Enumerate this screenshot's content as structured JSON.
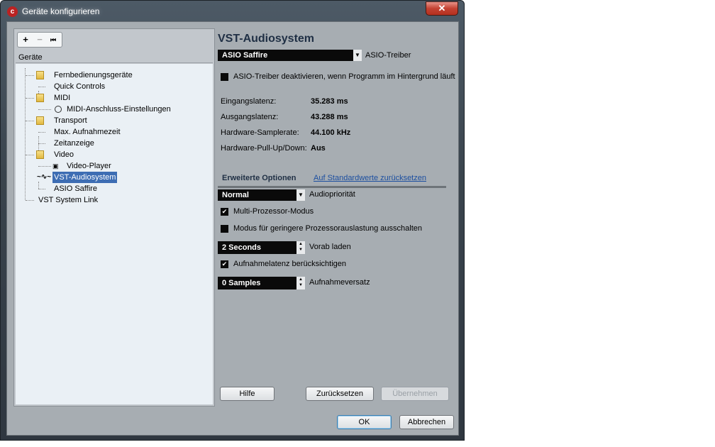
{
  "window": {
    "title": "Geräte konfigurieren",
    "close_label": "✕"
  },
  "toolbar": {
    "add": "+",
    "remove": "−",
    "reset": "⏮"
  },
  "tree": {
    "header": "Geräte",
    "items": [
      {
        "label": "Fernbedienungsgeräte"
      },
      {
        "label": "Quick Controls"
      },
      {
        "label": "MIDI"
      },
      {
        "label": "MIDI-Anschluss-Einstellungen"
      },
      {
        "label": "Transport"
      },
      {
        "label": "Max. Aufnahmezeit"
      },
      {
        "label": "Zeitanzeige"
      },
      {
        "label": "Video"
      },
      {
        "label": "Video-Player"
      },
      {
        "label": "VST-Audiosystem"
      },
      {
        "label": "ASIO Saffire"
      },
      {
        "label": "VST System Link"
      }
    ]
  },
  "panel": {
    "title": "VST-Audiosystem",
    "asio_driver": {
      "value": "ASIO Saffire",
      "label": "ASIO-Treiber"
    },
    "deactivate_label": "ASIO-Treiber deaktivieren, wenn Programm im Hintergrund läuft",
    "stats": [
      {
        "label": "Eingangslatenz:",
        "value": "35.283 ms"
      },
      {
        "label": "Ausgangslatenz:",
        "value": "43.288 ms"
      },
      {
        "label": "Hardware-Samplerate:",
        "value": "44.100 kHz"
      },
      {
        "label": "Hardware-Pull-Up/Down:",
        "value": "Aus"
      }
    ],
    "advanced_label": "Erweiterte Optionen",
    "reset_link": "Auf Standardwerte zurücksetzen",
    "audio_priority": {
      "value": "Normal",
      "label": "Audiopriorität"
    },
    "multi_processor": {
      "label": "Multi-Prozessor-Modus",
      "checked": true
    },
    "low_load": {
      "label": "Modus für geringere Prozessorauslastung ausschalten",
      "checked": false
    },
    "preload": {
      "value": "2 Seconds",
      "label": "Vorab laden"
    },
    "record_latency": {
      "label": "Aufnahmelatenz berücksichtigen",
      "checked": true
    },
    "record_offset": {
      "value": "0 Samples",
      "label": "Aufnahmeversatz"
    },
    "buttons": {
      "help": "Hilfe",
      "reset": "Zurücksetzen",
      "apply": "Übernehmen"
    }
  },
  "footer": {
    "ok": "OK",
    "cancel": "Abbrechen"
  }
}
